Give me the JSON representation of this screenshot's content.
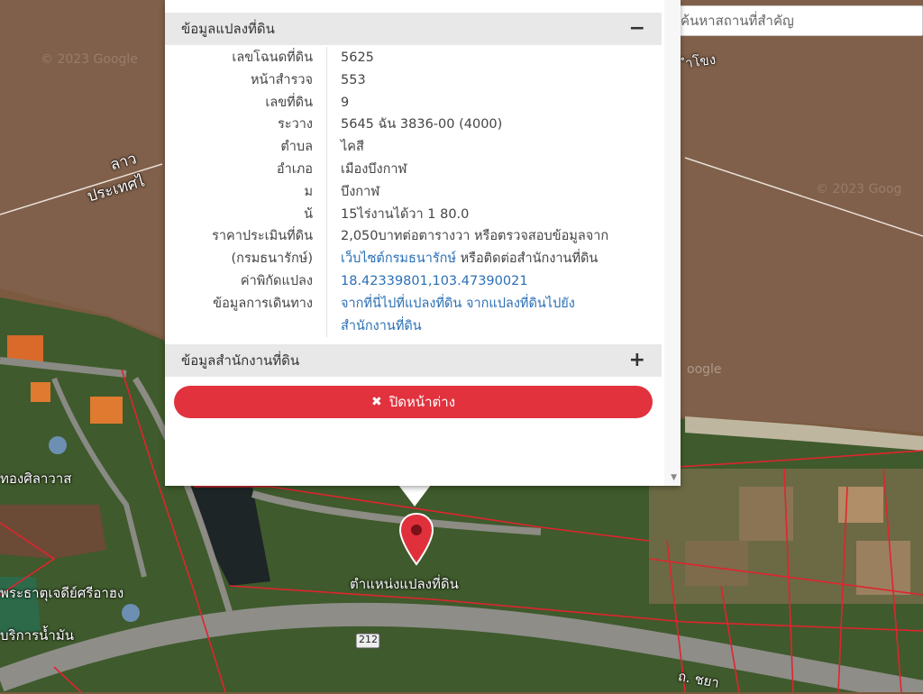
{
  "search": {
    "placeholder": "ค้นหาสถานที่สำคัญ"
  },
  "panel_parcel": {
    "title": "ข้อมูลแปลงที่ดิน",
    "toggle": "−"
  },
  "panel_office": {
    "title": "ข้อมูลสำนักงานที่ดิน",
    "toggle": "+"
  },
  "info": {
    "rows": [
      {
        "label": "เลขโฉนดที่ดิน",
        "value": "5625"
      },
      {
        "label": "หน้าสำรวจ",
        "value": "553"
      },
      {
        "label": "เลขที่ดิน",
        "value": "9"
      },
      {
        "label": "ระวาง",
        "value": "5645 ฉัน 3836-00 (4000)"
      },
      {
        "label": "ตำบล",
        "value": "ไคสี"
      },
      {
        "label": "อำเภอ",
        "value": "เมืองบึงกาฬ"
      },
      {
        "label": "ม",
        "value": "บึงกาฬ"
      },
      {
        "label": "น้",
        "value": "15ไร่งานได้วา 1 80.0"
      }
    ],
    "price_label_1": "ราคาประเมินที่ดิน",
    "price_label_2": "(กรมธนารักษ์)",
    "price_text_1": "2,050บาทต่อตารางวา หรือตรวจสอบข้อมูลจาก",
    "price_link": "เว็บไซต์กรมธนารักษ์",
    "price_text_2": " หรือติดต่อสำนักงานที่ดิน",
    "coord_label": "ค่าพิกัดแปลง",
    "coord_value": "18.42339801,103.47390021",
    "route_label": "ข้อมูลการเดินทาง",
    "route_link_1": "จากที่นี่ไปที่แปลงที่ดิน",
    "route_link_2": "จากแปลงที่ดินไปยัง",
    "route_link_3": "สำนักงานที่ดิน"
  },
  "close_button": {
    "icon": "✖",
    "label": "ปิดหน้าต่าง"
  },
  "map": {
    "marker_label": "ตำแหน่งแปลงที่ดิน",
    "labels": {
      "laos": "ลาว",
      "laos_country": "ประเทศไ",
      "river_right": "ำโขง",
      "temple_left": "ทองศิลาวาส",
      "pagoda": "พระธาตุเจดีย์ศรีอาฮง",
      "fuel": "บริการน้ำมัน",
      "road_sign": "212",
      "road_bottom": "ถ. ชยา",
      "google": "oogle"
    },
    "watermarks": [
      "© 2023 Google",
      "© 2023 Goog"
    ]
  },
  "colors": {
    "close_button": "#e1323e",
    "link": "#2a6fb4",
    "marker": "#e0303c",
    "parcel_line": "#e0242f"
  }
}
